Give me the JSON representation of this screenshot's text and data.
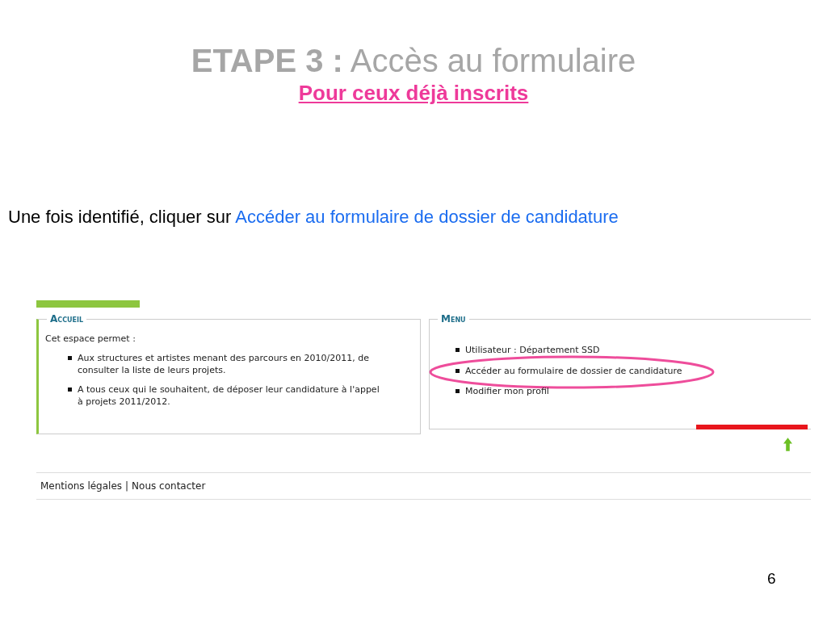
{
  "slide": {
    "title": "**ETAPE 3 :** Accès au formulaire",
    "subtitle": "Pour ceux déjà inscrits",
    "instruction": "Une fois identifié, cliquer sur",
    "instruction_link": "Accéder au formulaire de dossier de candidature",
    "page_number": "6"
  },
  "screenshot": {
    "accueil": {
      "legend": "Accueil",
      "intro": "Cet espace permet :",
      "items": [
        "Aux structures et artistes menant des parcours en 2010/2011, de consulter la liste de leurs projets.",
        "A tous ceux qui le souhaitent, de déposer leur candidature à l'appel à projets 2011/2012."
      ]
    },
    "menu": {
      "legend": "Menu",
      "items": [
        {
          "text": "Utilisateur : Département SSD",
          "highlighted": false
        },
        {
          "text": "Accéder au formulaire de dossier de candidature",
          "highlighted": true
        },
        {
          "text": "Modifier mon profil",
          "highlighted": false
        }
      ]
    },
    "footer": {
      "links": [
        "Mentions légales",
        "Nous contacter"
      ],
      "separator": "|"
    }
  }
}
